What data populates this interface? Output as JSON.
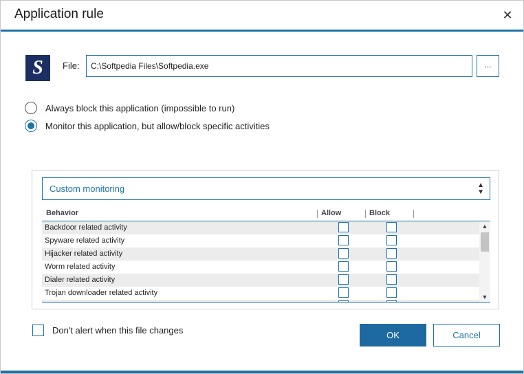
{
  "window": {
    "title": "Application rule"
  },
  "file": {
    "label": "File:",
    "value": "C:\\Softpedia Files\\Softpedia.exe",
    "browse_label": "..."
  },
  "options": [
    {
      "label": "Always block this application (impossible to run)",
      "checked": false
    },
    {
      "label": "Monitor this application, but allow/block specific activities",
      "checked": true
    }
  ],
  "monitoring": {
    "selected": "Custom monitoring",
    "columns": [
      "Behavior",
      "Allow",
      "Block"
    ],
    "rows": [
      {
        "behavior": "Backdoor related activity",
        "allow": false,
        "block": false
      },
      {
        "behavior": "Spyware related activity",
        "allow": false,
        "block": false
      },
      {
        "behavior": "Hijacker related activity",
        "allow": false,
        "block": false
      },
      {
        "behavior": "Worm related activity",
        "allow": false,
        "block": false
      },
      {
        "behavior": "Dialer related activity",
        "allow": false,
        "block": false
      },
      {
        "behavior": "Trojan downloader related activity",
        "allow": false,
        "block": false
      }
    ]
  },
  "alert_option": {
    "label": "Don't alert when this file changes",
    "checked": false
  },
  "buttons": {
    "ok": "OK",
    "cancel": "Cancel"
  },
  "colors": {
    "accent": "#1e73a8",
    "primary_button": "#1e6aa0"
  },
  "icons": {
    "app": "softpedia-logo-icon",
    "close": "close-icon"
  },
  "app_icon_letter": "S"
}
